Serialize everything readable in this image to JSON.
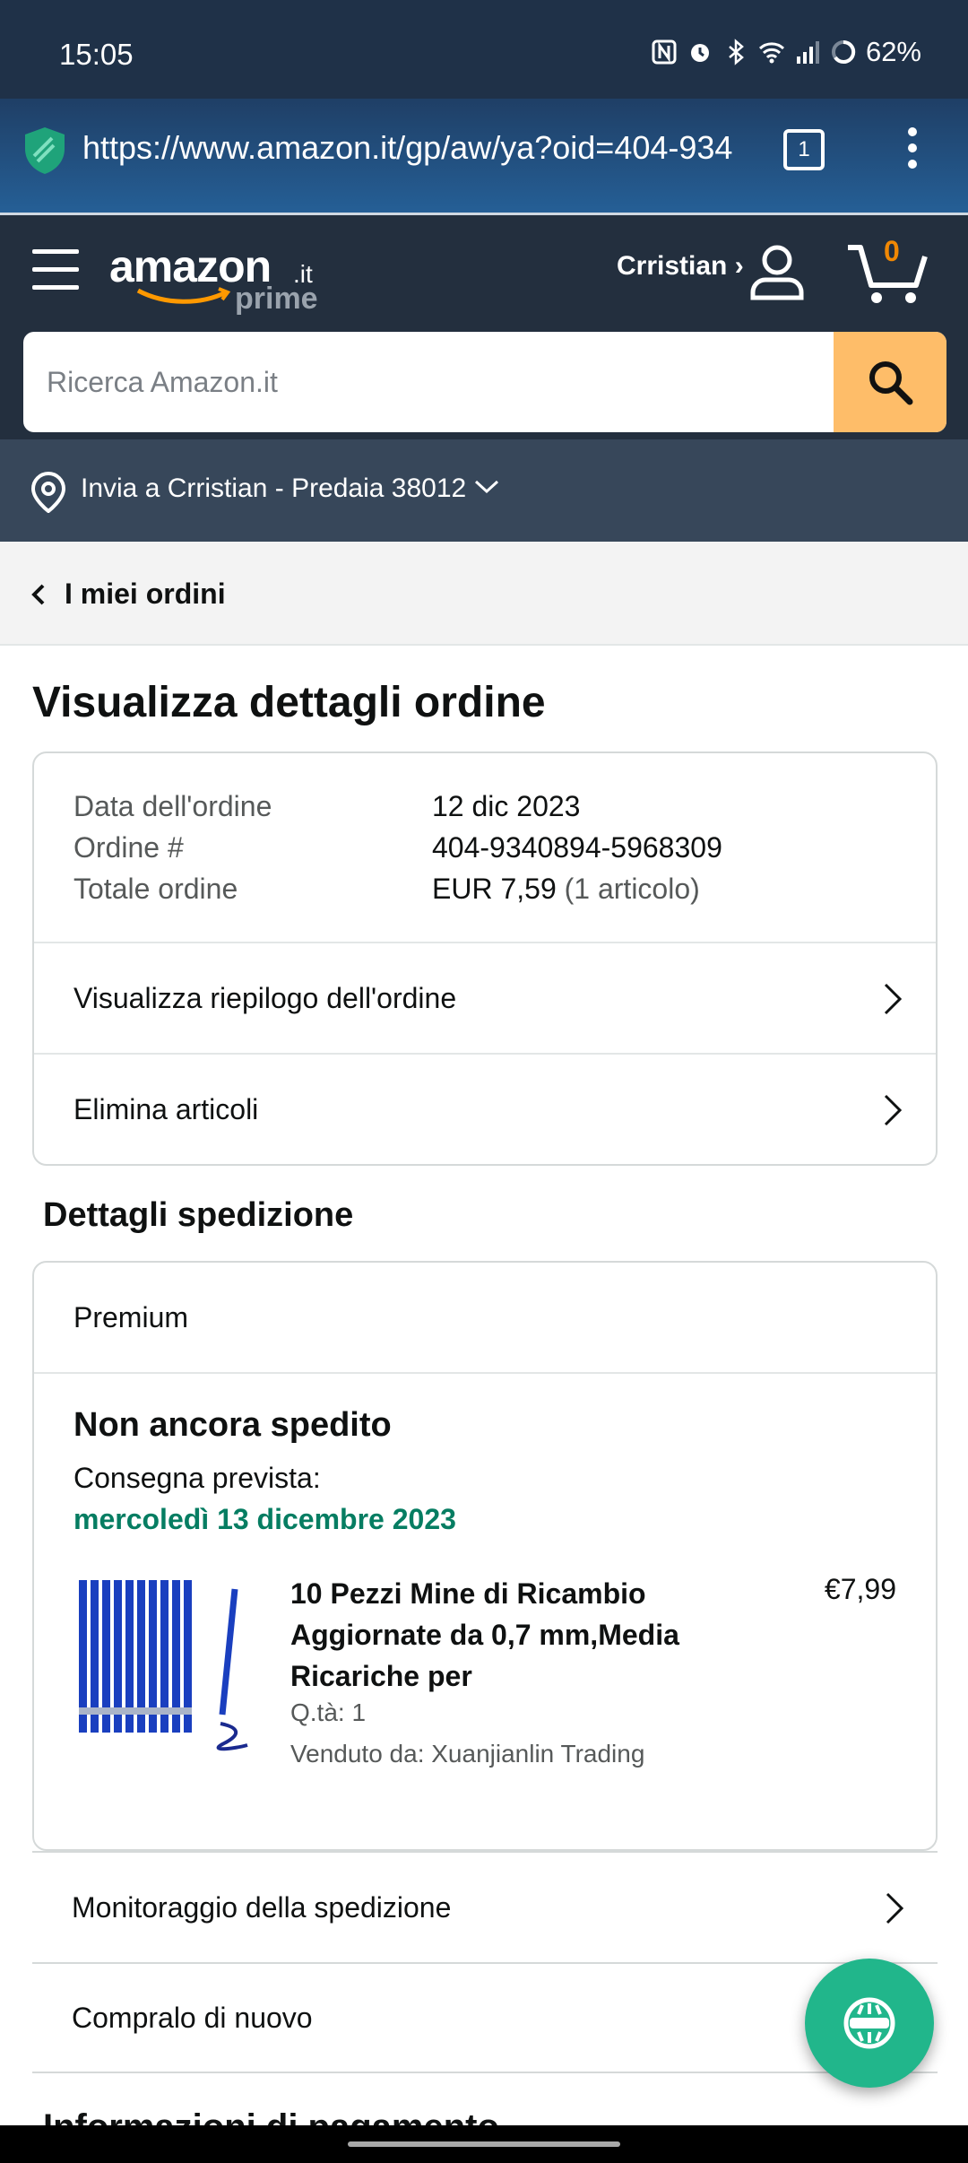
{
  "status_bar": {
    "time": "15:05",
    "battery": "62%"
  },
  "browser": {
    "url": "https://www.amazon.it/gp/aw/ya?oid=404-934",
    "tab_count": "1"
  },
  "header": {
    "logo_word": "amazon",
    "logo_tld": ".it",
    "logo_prime": "prime",
    "account_label": "Crristian ›",
    "cart_count": "0",
    "search_placeholder": "Ricerca Amazon.it"
  },
  "delivery": {
    "label": "Invia a Crristian - Predaia 38012"
  },
  "breadcrumb": {
    "label": "I miei ordini"
  },
  "page": {
    "title": "Visualizza dettagli ordine"
  },
  "order_info": {
    "date_label": "Data dell'ordine",
    "date_value": "12 dic 2023",
    "number_label": "Ordine #",
    "number_value": "404-9340894-5968309",
    "total_label": "Totale ordine",
    "total_value": "EUR 7,59",
    "total_items": "(1 articolo)"
  },
  "order_links": {
    "summary": "Visualizza riepilogo dell'ordine",
    "delete": "Elimina articoli"
  },
  "shipping": {
    "section_title": "Dettagli spedizione",
    "type": "Premium",
    "status": "Non ancora spedito",
    "delivery_label": "Consegna prevista:",
    "delivery_date": "mercoledì 13 dicembre 2023",
    "product_title": "10 Pezzi Mine di Ricambio Aggiornate da 0,7 mm,Media Ricariche per",
    "price": "€7,99",
    "qty": "Q.tà: 1",
    "seller": "Venduto da: Xuanjianlin Trading"
  },
  "actions": {
    "track": "Monitoraggio della spedizione",
    "buy_again": "Compralo di nuovo"
  },
  "next_section": {
    "title": "Informazioni di pagamento"
  },
  "colors": {
    "header_bg": "#232f3e",
    "search_button": "#febd69",
    "delivery_date_green": "#067d62",
    "fab": "#21b68b"
  }
}
